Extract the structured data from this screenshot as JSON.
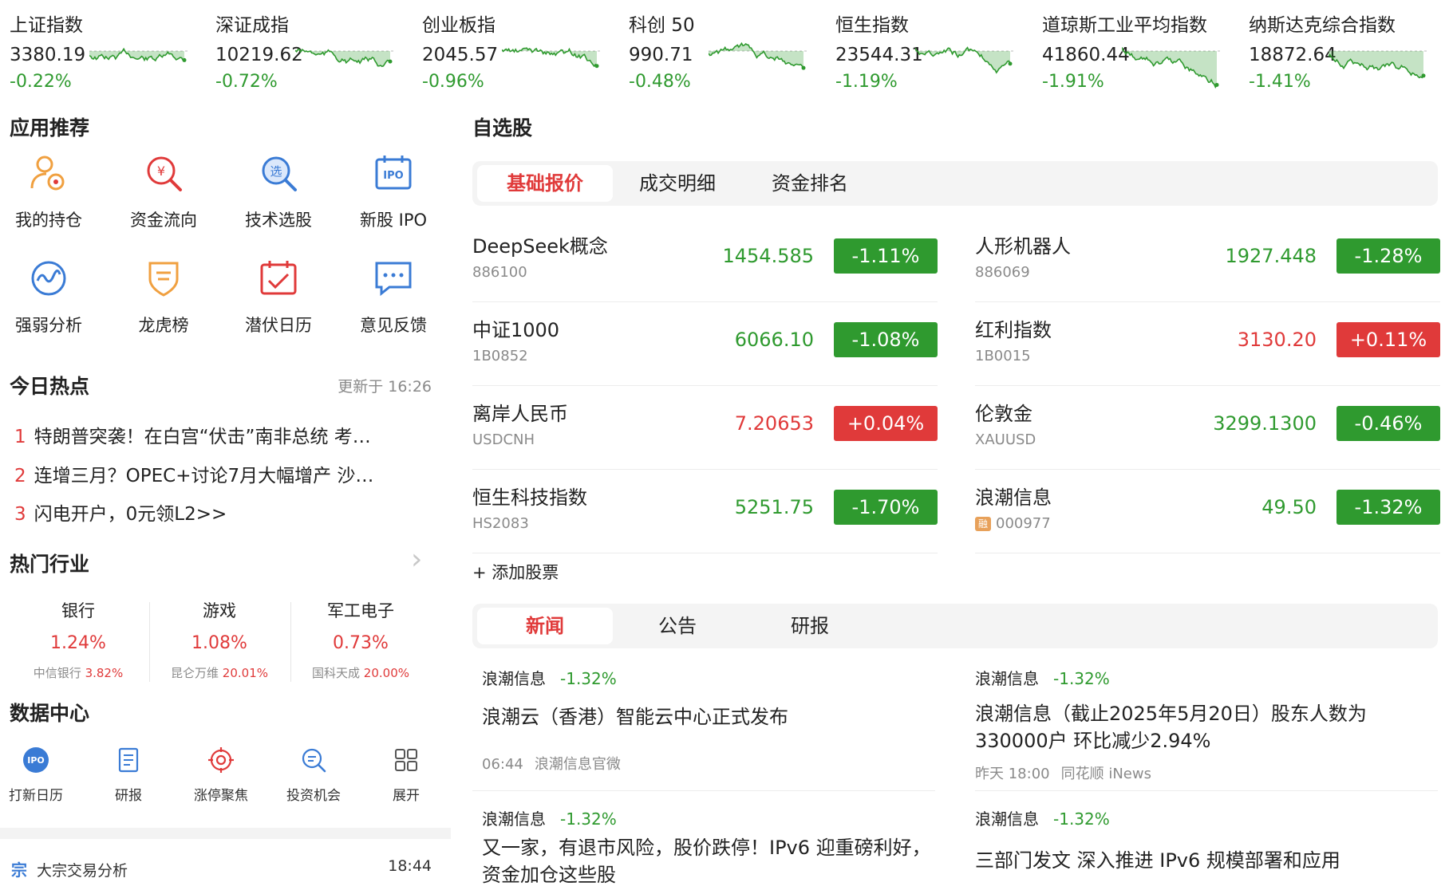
{
  "tickers": [
    {
      "name": "上证指数",
      "value": "3380.19",
      "change": "-0.22%",
      "trend": "mixed"
    },
    {
      "name": "深证成指",
      "value": "10219.62",
      "change": "-0.72%",
      "trend": "down"
    },
    {
      "name": "创业板指",
      "value": "2045.57",
      "change": "-0.96%",
      "trend": "down"
    },
    {
      "name": "科创 50",
      "value": "990.71",
      "change": "-0.48%",
      "trend": "mixed"
    },
    {
      "name": "恒生指数",
      "value": "23544.31",
      "change": "-1.19%",
      "trend": "down"
    },
    {
      "name": "道琼斯工业平均指数",
      "value": "41860.44",
      "change": "-1.91%",
      "trend": "down"
    },
    {
      "name": "纳斯达克综合指数",
      "value": "18872.64",
      "change": "-1.41%",
      "trend": "mixed"
    }
  ],
  "apps": {
    "title": "应用推荐",
    "items": [
      {
        "label": "我的持仓",
        "icon": "portfolio-icon"
      },
      {
        "label": "资金流向",
        "icon": "money-flow-icon"
      },
      {
        "label": "技术选股",
        "icon": "stock-picker-icon"
      },
      {
        "label": "新股 IPO",
        "icon": "ipo-calendar-icon"
      },
      {
        "label": "强弱分析",
        "icon": "strength-wave-icon"
      },
      {
        "label": "龙虎榜",
        "icon": "badge-shield-icon"
      },
      {
        "label": "潜伏日历",
        "icon": "calendar-check-icon"
      },
      {
        "label": "意见反馈",
        "icon": "chat-bubble-icon"
      }
    ]
  },
  "hot": {
    "title": "今日热点",
    "updated": "更新于 16:26",
    "items": [
      {
        "num": "1",
        "text": "特朗普突袭！在白宫“伏击”南非总统 考…"
      },
      {
        "num": "2",
        "text": "连增三月？OPEC+讨论7月大幅增产 沙…"
      },
      {
        "num": "3",
        "text": "闪电开户，0元领L2>>"
      }
    ]
  },
  "industry": {
    "title": "热门行业",
    "arrow": "›",
    "items": [
      {
        "name": "银行",
        "pct": "1.24%",
        "lead": "中信银行",
        "lead_pct": "3.82%"
      },
      {
        "name": "游戏",
        "pct": "1.08%",
        "lead": "昆仑万维",
        "lead_pct": "20.01%"
      },
      {
        "name": "军工电子",
        "pct": "0.73%",
        "lead": "国科天成",
        "lead_pct": "20.00%"
      }
    ]
  },
  "data_center": {
    "title": "数据中心",
    "items": [
      {
        "label": "打新日历",
        "icon": "ipo-icon"
      },
      {
        "label": "研报",
        "icon": "report-icon"
      },
      {
        "label": "涨停聚焦",
        "icon": "target-icon"
      },
      {
        "label": "投资机会",
        "icon": "search-list-icon"
      },
      {
        "label": "展开",
        "icon": "grid-icon"
      }
    ]
  },
  "bulk": {
    "tag": "宗",
    "label": "大宗交易分析",
    "time": "18:44"
  },
  "watchlist": {
    "title": "自选股",
    "tabs": [
      "基础报价",
      "成交明细",
      "资金排名"
    ],
    "add_label": "+ 添加股票",
    "items": [
      {
        "name": "DeepSeek概念",
        "code": "886100",
        "price": "1454.585",
        "change": "-1.11%",
        "dir": "down"
      },
      {
        "name": "人形机器人",
        "code": "886069",
        "price": "1927.448",
        "change": "-1.28%",
        "dir": "down"
      },
      {
        "name": "中证1000",
        "code": "1B0852",
        "price": "6066.10",
        "change": "-1.08%",
        "dir": "down"
      },
      {
        "name": "红利指数",
        "code": "1B0015",
        "price": "3130.20",
        "change": "+0.11%",
        "dir": "up"
      },
      {
        "name": "离岸人民币",
        "code": "USDCNH",
        "price": "7.20653",
        "change": "+0.04%",
        "dir": "up"
      },
      {
        "name": "伦敦金",
        "code": "XAUUSD",
        "price": "3299.1300",
        "change": "-0.46%",
        "dir": "down"
      },
      {
        "name": "恒生科技指数",
        "code": "HS2083",
        "price": "5251.75",
        "change": "-1.70%",
        "dir": "down"
      },
      {
        "name": "浪潮信息",
        "code": "000977",
        "price": "49.50",
        "change": "-1.32%",
        "dir": "down",
        "tag": "融"
      }
    ]
  },
  "news": {
    "tabs": [
      "新闻",
      "公告",
      "研报"
    ],
    "items": [
      {
        "stock": "浪潮信息",
        "pct": "-1.32%",
        "title": "浪潮云（香港）智能云中心正式发布",
        "time": "06:44",
        "source": "浪潮信息官微"
      },
      {
        "stock": "浪潮信息",
        "pct": "-1.32%",
        "title": "浪潮信息（截止2025年5月20日）股东人数为330000户 环比减少2.94%",
        "time": "昨天 18:00",
        "source": "同花顺 iNews"
      },
      {
        "stock": "浪潮信息",
        "pct": "-1.32%",
        "title": "又一家，有退市风险，股价跌停！IPv6 迎重磅利好，资金加仓这些股",
        "time": "",
        "source": ""
      },
      {
        "stock": "浪潮信息",
        "pct": "-1.32%",
        "title": "三部门发文 深入推进 IPv6 规模部署和应用",
        "time": "",
        "source": ""
      }
    ]
  },
  "colors": {
    "up": "#e03a3a",
    "down": "#2f9a2f",
    "accent": "#3a7bd5",
    "icon_orange": "#f0a040"
  }
}
